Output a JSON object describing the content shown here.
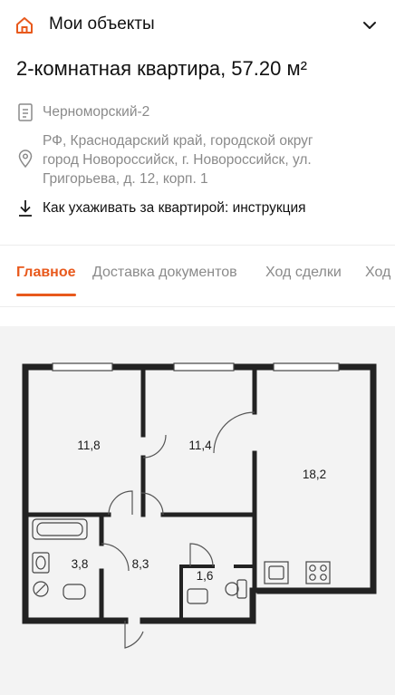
{
  "topbar": {
    "title": "Мои объекты",
    "home_icon": "home-icon",
    "expand_icon": "chevron-down-icon"
  },
  "listing": {
    "title": "2-комнатная квартира, 57.20 м²",
    "project": "Черноморский-2",
    "address_lines": [
      "РФ, Краснодарский край, городской округ",
      "город Новороссийск, г. Новороссийск, ул.",
      "Григорьева, д. 12, корп. 1"
    ],
    "instruction_link": "Как ухаживать за квартирой: инструкция"
  },
  "tabs": [
    {
      "label": "Главное",
      "active": true
    },
    {
      "label": "Доставка документов",
      "active": false
    },
    {
      "label": "Ход сделки",
      "active": false
    },
    {
      "label": "Ход",
      "active": false
    }
  ],
  "floorplan": {
    "rooms": [
      {
        "name": "bedroom-1",
        "area": "11,8"
      },
      {
        "name": "bedroom-2",
        "area": "11,4"
      },
      {
        "name": "kitchen-living",
        "area": "18,2"
      },
      {
        "name": "bathroom",
        "area": "3,8"
      },
      {
        "name": "hallway",
        "area": "8,3"
      },
      {
        "name": "toilet",
        "area": "1,6"
      }
    ]
  },
  "colors": {
    "accent": "#e8591c",
    "muted_text": "#8a8a8a",
    "plan_background": "#f3f3f3"
  }
}
